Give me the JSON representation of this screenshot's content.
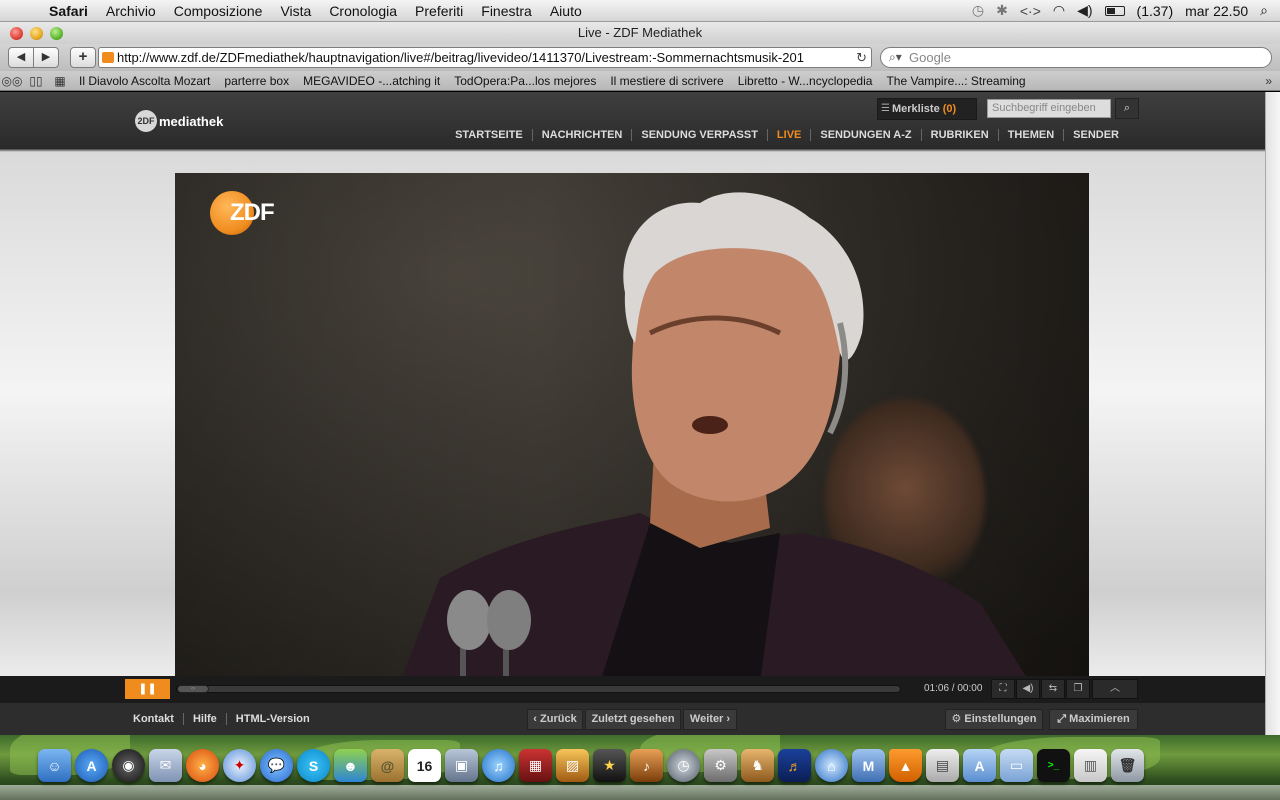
{
  "menubar": {
    "app": "Safari",
    "items": [
      "Archivio",
      "Composizione",
      "Vista",
      "Cronologia",
      "Preferiti",
      "Finestra",
      "Aiuto"
    ],
    "battery": "(1.37)",
    "clock": "mar 22.50"
  },
  "window": {
    "title": "Live - ZDF Mediathek"
  },
  "toolbar": {
    "url": "http://www.zdf.de/ZDFmediathek/hauptnavigation/live#/beitrag/livevideo/1411370/Livestream:-Sommernachtsmusik-201",
    "search_placeholder": "Google"
  },
  "bookmarks": [
    "Il Diavolo Ascolta Mozart",
    "parterre box",
    "MEGAVIDEO -...atching it",
    "TodOpera:Pa...los mejores",
    "Il mestiere di scrivere",
    "Libretto - W...ncyclopedia",
    "The Vampire...: Streaming"
  ],
  "zdf": {
    "logo_text": "mediathek",
    "logo_mark": "2DF",
    "merkliste_label": "Merkliste",
    "merkliste_count": "(0)",
    "search_placeholder": "Suchbegriff eingeben",
    "nav": [
      "STARTSEITE",
      "NACHRICHTEN",
      "SENDUNG VERPASST",
      "LIVE",
      "SENDUNGEN A-Z",
      "RUBRIKEN",
      "THEMEN",
      "SENDER"
    ],
    "nav_active": "LIVE"
  },
  "video": {
    "channel_bug": "ZDF",
    "time": "01:06 / 00:00"
  },
  "footer": {
    "links": [
      "Kontakt",
      "Hilfe",
      "HTML-Version"
    ],
    "zurueck": "Zurück",
    "zuletzt": "Zuletzt gesehen",
    "weiter": "Weiter",
    "einstellungen": "Einstellungen",
    "maximieren": "Maximieren"
  },
  "colors": {
    "accent": "#f08c1e"
  }
}
